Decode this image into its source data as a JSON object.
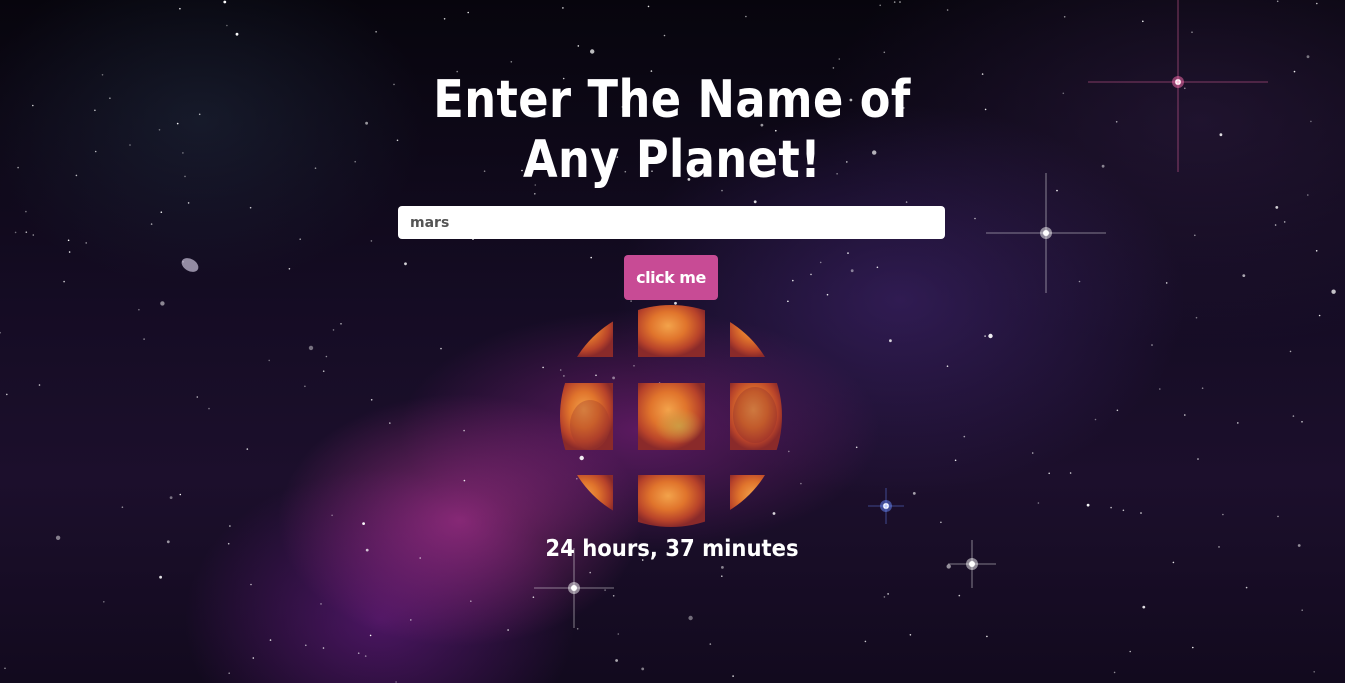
{
  "page": {
    "heading": "Enter The Name of Any Planet!"
  },
  "search": {
    "value": "mars",
    "placeholder": ""
  },
  "submit": {
    "label": "click me"
  },
  "result": {
    "planet_name": "mars",
    "rotation_period": "24 hours, 37 minutes"
  },
  "colors": {
    "button_background": "#c84b95",
    "heading_text": "#ffffff",
    "input_background": "#ffffff"
  }
}
